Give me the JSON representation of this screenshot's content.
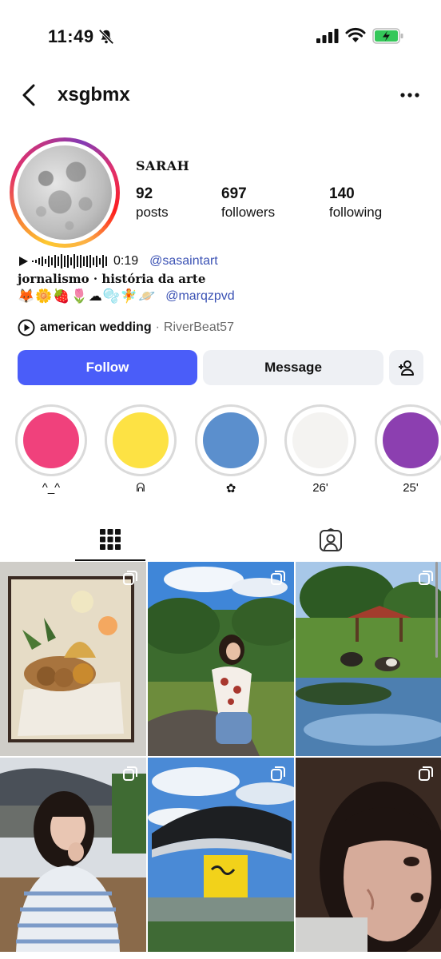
{
  "status_bar": {
    "time": "11:49"
  },
  "header": {
    "username": "xsgbmx"
  },
  "profile": {
    "display_name": "SARAH",
    "stats": [
      {
        "value": "92",
        "label": "posts"
      },
      {
        "value": "697",
        "label": "followers"
      },
      {
        "value": "140",
        "label": "following"
      }
    ],
    "audio_time": "0:19",
    "audio_link": "@sasaintart",
    "bio_line": "jornalismo · história da arte",
    "emojis": [
      "🦊",
      "🌼",
      "🍓",
      "🌷",
      "☁",
      "🫧",
      "🧚",
      "🪐"
    ],
    "emoji_link": "@marqzpvd",
    "music_title": "american wedding",
    "music_sep": "·",
    "music_artist": "RiverBeat57"
  },
  "actions": {
    "follow_label": "Follow",
    "message_label": "Message"
  },
  "highlights": [
    {
      "label": "^_^",
      "color": "#f0417c"
    },
    {
      "label": "ᕱ",
      "color": "#fde244"
    },
    {
      "label": "✿",
      "color": "#5b8fcd"
    },
    {
      "label": "26'",
      "color": "#f4f3f1"
    },
    {
      "label": "25'",
      "color": "#8c3fb0"
    }
  ],
  "colors": {
    "accent": "#4a5df9",
    "link": "#3b52b4"
  },
  "icons": [
    "silent-bell-icon",
    "signal-icon",
    "wifi-icon",
    "battery-charging-icon",
    "back-arrow-icon",
    "more-options-icon",
    "play-icon",
    "waveform-icon",
    "music-play-icon",
    "add-user-icon",
    "grid-icon",
    "tagged-icon",
    "multiple-photos-icon"
  ]
}
